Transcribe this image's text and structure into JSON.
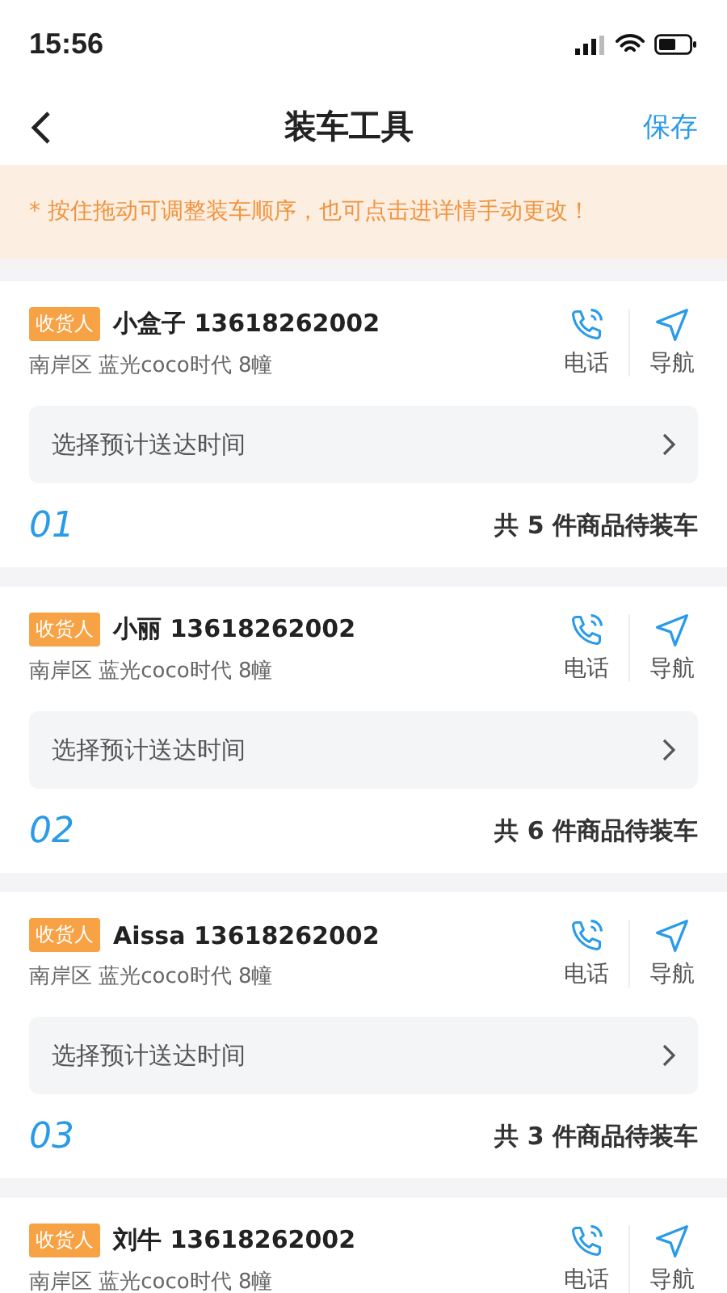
{
  "status_bar": {
    "time": "15:56"
  },
  "nav": {
    "title": "装车工具",
    "action": "保存"
  },
  "notice": "* 按住拖动可调整装车顺序，也可点击进详情手动更改！",
  "orders": [
    {
      "tag": "收货人",
      "name": "小盒子 13618262002",
      "address": "南岸区 蓝光coco时代 8幢",
      "call": "电话",
      "navigate": "导航",
      "time_placeholder": "选择预计送达时间",
      "number": "01",
      "count": "共 5 件商品待装车"
    },
    {
      "tag": "收货人",
      "name": "小丽 13618262002",
      "address": "南岸区 蓝光coco时代 8幢",
      "call": "电话",
      "navigate": "导航",
      "time_placeholder": "选择预计送达时间",
      "number": "02",
      "count": "共 6 件商品待装车"
    },
    {
      "tag": "收货人",
      "name": "Aissa 13618262002",
      "address": "南岸区 蓝光coco时代 8幢",
      "call": "电话",
      "navigate": "导航",
      "time_placeholder": "选择预计送达时间",
      "number": "03",
      "count": "共 3 件商品待装车"
    },
    {
      "tag": "收货人",
      "name": "刘牛 13618262002",
      "address": "南岸区 蓝光coco时代 8幢",
      "call": "电话",
      "navigate": "导航"
    }
  ]
}
